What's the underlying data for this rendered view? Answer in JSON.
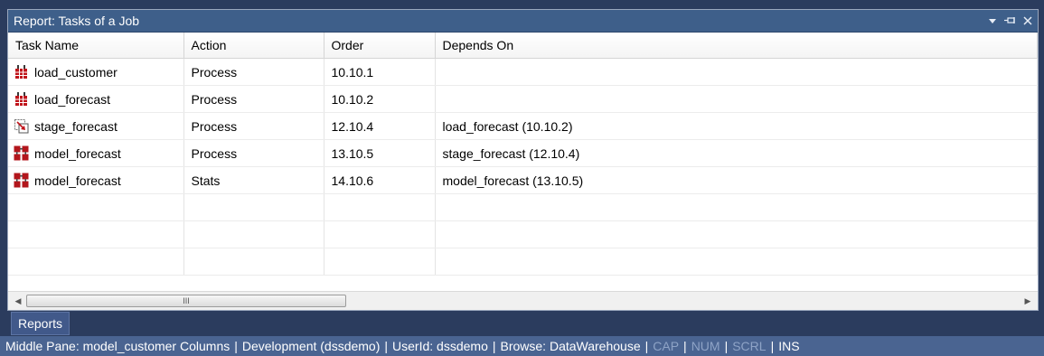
{
  "panel": {
    "title": "Report: Tasks of a Job",
    "controls": {
      "menu_icon": "dropdown-arrow-icon",
      "pin_icon": "pin-icon",
      "close_icon": "close-icon"
    }
  },
  "table": {
    "columns": [
      "Task Name",
      "Action",
      "Order",
      "Depends On"
    ],
    "rows": [
      {
        "icon": "load-table-icon",
        "name": "load_customer",
        "action": "Process",
        "order": "10.10.1",
        "depends": ""
      },
      {
        "icon": "load-table-icon",
        "name": "load_forecast",
        "action": "Process",
        "order": "10.10.2",
        "depends": ""
      },
      {
        "icon": "stage-table-icon",
        "name": "stage_forecast",
        "action": "Process",
        "order": "12.10.4",
        "depends": "load_forecast (10.10.2)"
      },
      {
        "icon": "model-table-icon",
        "name": "model_forecast",
        "action": "Process",
        "order": "13.10.5",
        "depends": "stage_forecast (12.10.4)"
      },
      {
        "icon": "model-table-icon",
        "name": "model_forecast",
        "action": "Stats",
        "order": "14.10.6",
        "depends": "model_forecast (13.10.5)"
      }
    ]
  },
  "scrollbar": {
    "grip": "III"
  },
  "bottom_tab": {
    "label": "Reports"
  },
  "statusbar": {
    "pane": "Middle Pane: model_customer Columns",
    "environment": "Development (dssdemo)",
    "user": "UserId: dssdemo",
    "browse": "Browse: DataWarehouse",
    "cap": "CAP",
    "num": "NUM",
    "scrl": "SCRL",
    "ins": "INS"
  },
  "colors": {
    "title_bar": "#3e5f8a",
    "status_bar": "#4a6491",
    "background": "#2b3c5e",
    "load_icon": "#c0141b",
    "model_icon": "#b3161c"
  }
}
